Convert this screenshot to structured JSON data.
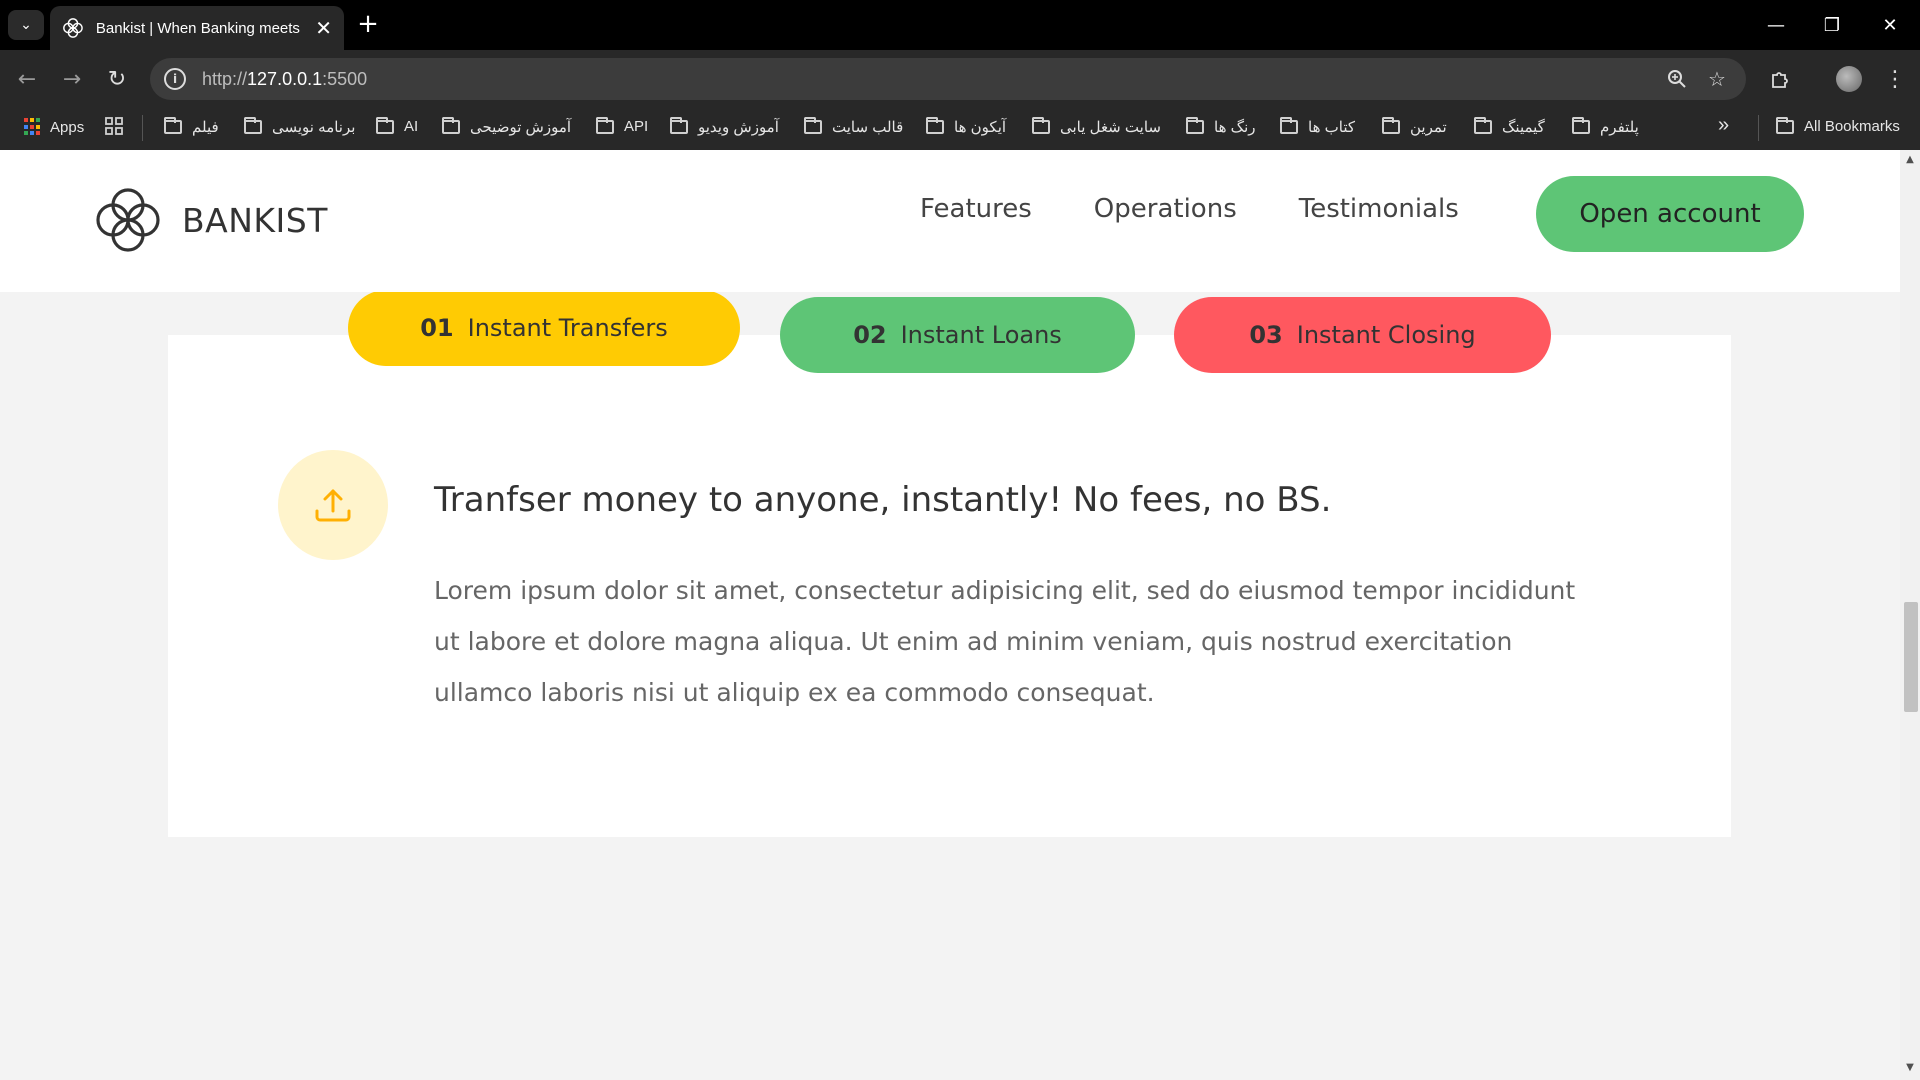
{
  "browser": {
    "tab_title": "Bankist | When Banking meets Minimalist",
    "tab_close": "✕",
    "new_tab": "+",
    "url_scheme": "http://",
    "url_host": "127.0.0.1",
    "url_port": ":5500",
    "window_controls": {
      "minimize": "—",
      "restore": "❐",
      "close": "✕"
    },
    "bookmarks": [
      {
        "label": "Apps",
        "icon": "apps-grid-icon"
      },
      {
        "label": "فیلم",
        "icon": "folder-icon"
      },
      {
        "label": "برنامه نویسی",
        "icon": "folder-icon"
      },
      {
        "label": "AI",
        "icon": "folder-icon"
      },
      {
        "label": "آموزش توضیحی",
        "icon": "folder-icon"
      },
      {
        "label": "API",
        "icon": "folder-icon"
      },
      {
        "label": "آموزش ویدیو",
        "icon": "folder-icon"
      },
      {
        "label": "قالب سایت",
        "icon": "folder-icon"
      },
      {
        "label": "آیکون ها",
        "icon": "folder-icon"
      },
      {
        "label": "سایت شغل یابی",
        "icon": "folder-icon"
      },
      {
        "label": "رنگ ها",
        "icon": "folder-icon"
      },
      {
        "label": "کتاب ها",
        "icon": "folder-icon"
      },
      {
        "label": "تمرین",
        "icon": "folder-icon"
      },
      {
        "label": "گیمینگ",
        "icon": "folder-icon"
      },
      {
        "label": "پلتفرم",
        "icon": "folder-icon"
      }
    ],
    "more_bookmarks": "»",
    "all_bookmarks": "All Bookmarks"
  },
  "site": {
    "logo_text": "BANKIST",
    "nav": [
      "Features",
      "Operations",
      "Testimonials"
    ],
    "cta": "Open account"
  },
  "operations": {
    "tabs": [
      {
        "num": "01",
        "label": "Instant Transfers",
        "color": "#ffcb03"
      },
      {
        "num": "02",
        "label": "Instant Loans",
        "color": "#5ec576"
      },
      {
        "num": "03",
        "label": "Instant Closing",
        "color": "#ff585f"
      }
    ],
    "active": {
      "icon": "upload-icon",
      "heading": "Tranfser money to anyone, instantly! No fees, no BS.",
      "body": "Lorem ipsum dolor sit amet, consectetur adipisicing elit, sed do eiusmod tempor incididunt ut labore et dolore magna aliqua. Ut enim ad minim veniam, quis nostrud exercitation ullamco laboris nisi ut aliquip ex ea commodo consequat."
    }
  },
  "colors": {
    "brand_green": "#5ec576",
    "brand_yellow": "#ffcb03",
    "brand_red": "#ff585f"
  }
}
